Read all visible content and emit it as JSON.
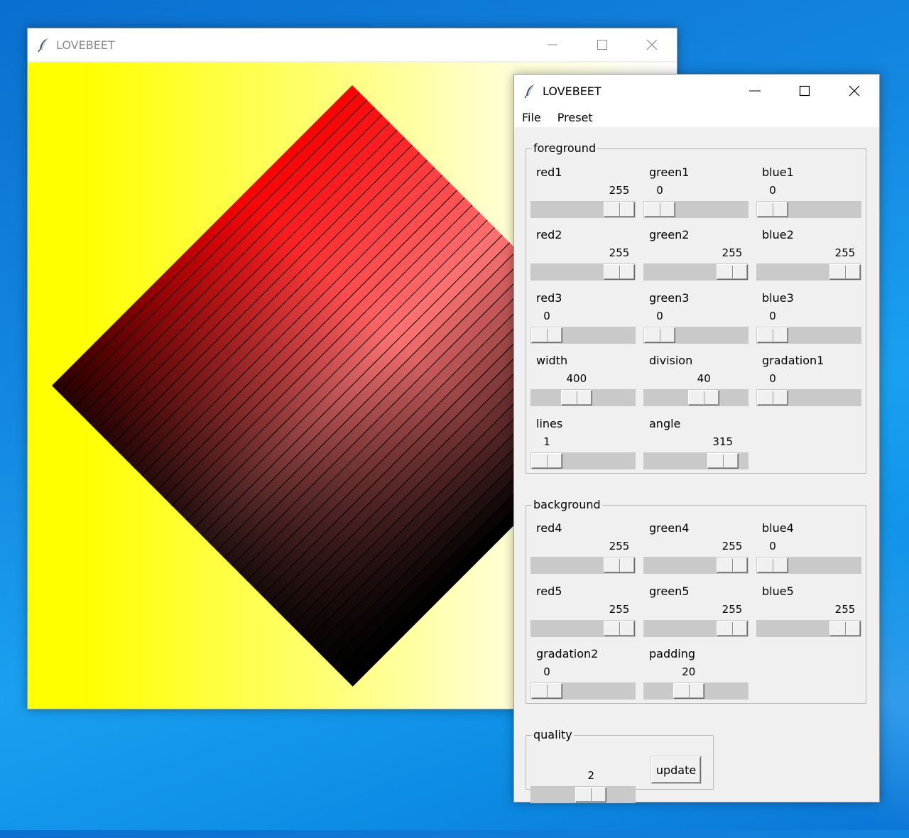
{
  "colors": {
    "bg_gradient": [
      "#ffff00",
      "#ffffff"
    ],
    "fg_start": "#ff0000",
    "fg_mid": "#ffffff",
    "fg_end": "#000000",
    "line_color": "#000000"
  },
  "canvas_window": {
    "title": "LOVEBEET",
    "icon": "feather-icon"
  },
  "control_window": {
    "title": "LOVEBEET",
    "icon": "feather-icon",
    "menu": [
      "File",
      "Preset"
    ]
  },
  "foreground": {
    "legend": "foreground",
    "sliders": [
      {
        "label": "red1",
        "value": "255",
        "pos": 1.0
      },
      {
        "label": "green1",
        "value": "0",
        "pos": 0.0
      },
      {
        "label": "blue1",
        "value": "0",
        "pos": 0.0
      },
      {
        "label": "red2",
        "value": "255",
        "pos": 1.0
      },
      {
        "label": "green2",
        "value": "255",
        "pos": 1.0
      },
      {
        "label": "blue2",
        "value": "255",
        "pos": 1.0
      },
      {
        "label": "red3",
        "value": "0",
        "pos": 0.0
      },
      {
        "label": "green3",
        "value": "0",
        "pos": 0.0
      },
      {
        "label": "blue3",
        "value": "0",
        "pos": 0.0
      },
      {
        "label": "width",
        "value": "400",
        "pos": 0.41
      },
      {
        "label": "division",
        "value": "40",
        "pos": 0.61
      },
      {
        "label": "gradation1",
        "value": "0",
        "pos": 0.0
      },
      {
        "label": "lines",
        "value": "1",
        "pos": 0.0
      },
      {
        "label": "angle",
        "value": "315",
        "pos": 0.87
      }
    ]
  },
  "background": {
    "legend": "background",
    "sliders": [
      {
        "label": "red4",
        "value": "255",
        "pos": 1.0
      },
      {
        "label": "green4",
        "value": "255",
        "pos": 1.0
      },
      {
        "label": "blue4",
        "value": "0",
        "pos": 0.0
      },
      {
        "label": "red5",
        "value": "255",
        "pos": 1.0
      },
      {
        "label": "green5",
        "value": "255",
        "pos": 1.0
      },
      {
        "label": "blue5",
        "value": "255",
        "pos": 1.0
      },
      {
        "label": "gradation2",
        "value": "0",
        "pos": 0.0
      },
      {
        "label": "padding",
        "value": "20",
        "pos": 0.4
      }
    ]
  },
  "quality": {
    "legend": "quality",
    "value": "2",
    "pos": 0.61,
    "update_label": "update"
  },
  "artwork": {
    "stripes": 40,
    "angle_deg": 315
  }
}
